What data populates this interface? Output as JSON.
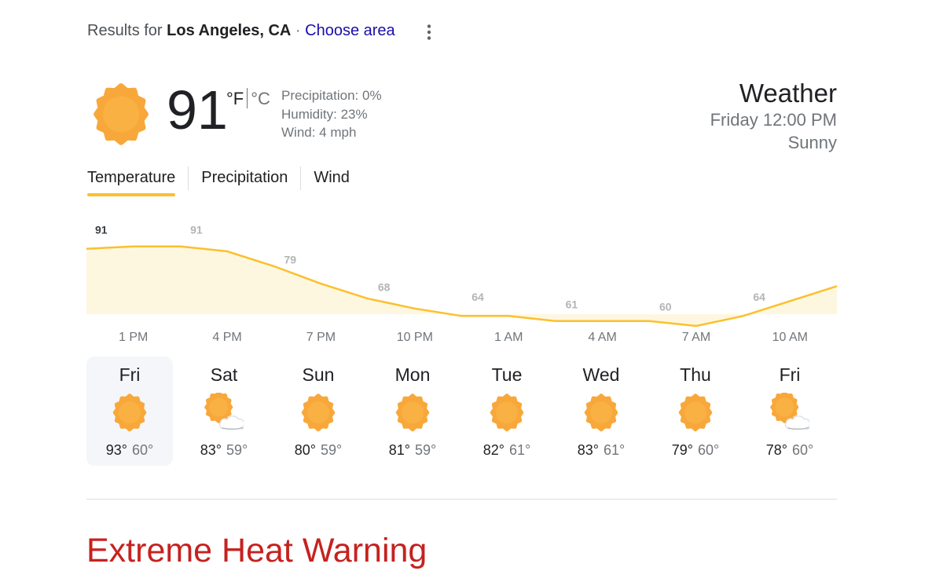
{
  "results": {
    "prefix": "Results for",
    "location": "Los Angeles, CA",
    "separator": "·",
    "choose_area": "Choose area"
  },
  "current": {
    "icon": "sunny-icon",
    "temperature": "91",
    "unit_f": "°F",
    "unit_c": "°C",
    "precipitation": "Precipitation: 0%",
    "humidity": "Humidity: 23%",
    "wind": "Wind: 4 mph"
  },
  "header": {
    "title": "Weather",
    "datetime": "Friday 12:00 PM",
    "condition": "Sunny"
  },
  "tabs": [
    {
      "label": "Temperature",
      "active": true
    },
    {
      "label": "Precipitation",
      "active": false
    },
    {
      "label": "Wind",
      "active": false
    }
  ],
  "colors": {
    "accent": "#fbc02d",
    "chart_fill": "#fef7e0",
    "warning": "#c5221f",
    "link": "#1a0dab"
  },
  "chart_data": {
    "type": "area",
    "x": [
      "1 PM",
      "4 PM",
      "7 PM",
      "10 PM",
      "1 AM",
      "4 AM",
      "7 AM",
      "10 AM"
    ],
    "values": [
      91,
      91,
      79,
      68,
      64,
      61,
      60,
      64
    ],
    "curve": [
      89,
      90,
      90,
      88,
      82,
      75,
      69,
      65,
      62,
      62,
      60,
      60,
      60,
      58,
      62,
      68,
      74
    ],
    "title": "",
    "xlabel": "",
    "ylabel": "",
    "grid": false
  },
  "forecast": [
    {
      "day": "Fri",
      "icon": "sunny-icon",
      "high": "93°",
      "low": "60°",
      "selected": true
    },
    {
      "day": "Sat",
      "icon": "partly-cloudy-icon",
      "high": "83°",
      "low": "59°",
      "selected": false
    },
    {
      "day": "Sun",
      "icon": "sunny-icon",
      "high": "80°",
      "low": "59°",
      "selected": false
    },
    {
      "day": "Mon",
      "icon": "sunny-icon",
      "high": "81°",
      "low": "59°",
      "selected": false
    },
    {
      "day": "Tue",
      "icon": "sunny-icon",
      "high": "82°",
      "low": "61°",
      "selected": false
    },
    {
      "day": "Wed",
      "icon": "sunny-icon",
      "high": "83°",
      "low": "61°",
      "selected": false
    },
    {
      "day": "Thu",
      "icon": "sunny-icon",
      "high": "79°",
      "low": "60°",
      "selected": false
    },
    {
      "day": "Fri",
      "icon": "partly-cloudy-icon",
      "high": "78°",
      "low": "60°",
      "selected": false
    }
  ],
  "alert": {
    "title": "Extreme Heat Warning"
  }
}
